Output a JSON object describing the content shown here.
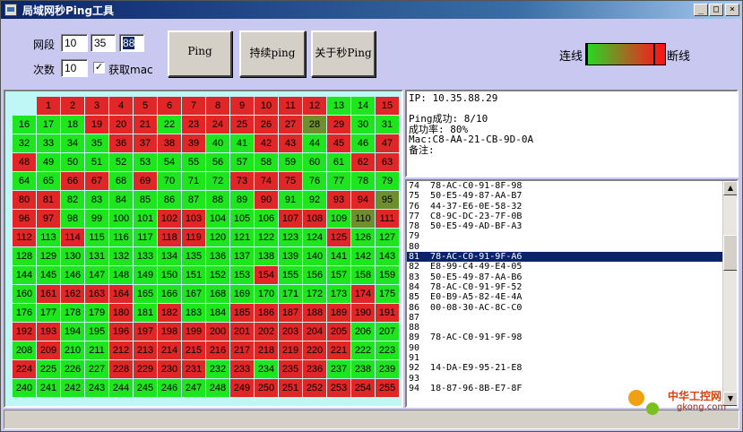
{
  "window": {
    "title": "局域网秒Ping工具",
    "controls": {
      "minimize": "_",
      "maximize": "□",
      "close": "×"
    }
  },
  "form": {
    "segment_label": "网段",
    "ip_parts": [
      "10",
      "35",
      "88"
    ],
    "count_label": "次数",
    "count_value": "10",
    "mac_checkbox_label": "获取mac",
    "mac_checked": true
  },
  "buttons": {
    "ping": "Ping",
    "continuous_ping": "持续ping",
    "about": "关于秒Ping"
  },
  "legend": {
    "connected": "连线",
    "disconnected": "断线",
    "connected_color": "#22dd22",
    "disconnected_color": "#ff1010"
  },
  "grid": {
    "states": "bOOOOOOOOOOOOggOgggOOOgOOOOOmOggggggOOOOggOOgOgOOgggggggggggggOOggOOgOgggOOOggggOOggggggggOggOOmOOggggOOgggOOgmOOgOgggOOgggggOggggggggggggggggggggggggggggOggggggOOOOgggggggggOgggggOgOggOOOOOOOOOggOOOOOOOOOOgggOggOOOOOOOOOOggOgggOOOOgOgOOggggggggggggOOOOOOOOOgggggggggggggggOOgggOOgggOOOOgOOOOOOOOOggggOOgggOOOOggOOOOOOOOOOOOOOOgggggg"
  },
  "info": {
    "ip_line": "IP: 10.35.88.29",
    "ping_success_line": "Ping成功: 8/10",
    "success_rate_line": "成功率: 80%",
    "mac_line": "Mac:C8-AA-21-CB-9D-0A",
    "remark_line": "备注:"
  },
  "mac_list": [
    {
      "n": "74",
      "mac": "78-AC-C0-91-8F-98"
    },
    {
      "n": "75",
      "mac": "50-E5-49-87-AA-B7"
    },
    {
      "n": "76",
      "mac": "44-37-E6-0E-58-32"
    },
    {
      "n": "77",
      "mac": "C8-9C-DC-23-7F-0B"
    },
    {
      "n": "78",
      "mac": "50-E5-49-AD-BF-A3"
    },
    {
      "n": "79",
      "mac": ""
    },
    {
      "n": "80",
      "mac": ""
    },
    {
      "n": "81",
      "mac": "78-AC-C0-91-9F-A6"
    },
    {
      "n": "82",
      "mac": "E8-99-C4-49-E4-05"
    },
    {
      "n": "83",
      "mac": "50-E5-49-87-AA-B6"
    },
    {
      "n": "84",
      "mac": "78-AC-C0-91-9F-52"
    },
    {
      "n": "85",
      "mac": "E0-B9-A5-82-4E-4A"
    },
    {
      "n": "86",
      "mac": "00-08-30-AC-8C-C0"
    },
    {
      "n": "87",
      "mac": ""
    },
    {
      "n": "88",
      "mac": ""
    },
    {
      "n": "89",
      "mac": "78-AC-C0-91-9F-98"
    },
    {
      "n": "90",
      "mac": ""
    },
    {
      "n": "91",
      "mac": ""
    },
    {
      "n": "92",
      "mac": "14-DA-E9-95-21-E8"
    },
    {
      "n": "93",
      "mac": ""
    },
    {
      "n": "94",
      "mac": "18-87-96-8B-E7-8F"
    }
  ],
  "mac_list_selected": "81",
  "watermark": {
    "name": "中华工控网",
    "url": "gkong.com"
  }
}
